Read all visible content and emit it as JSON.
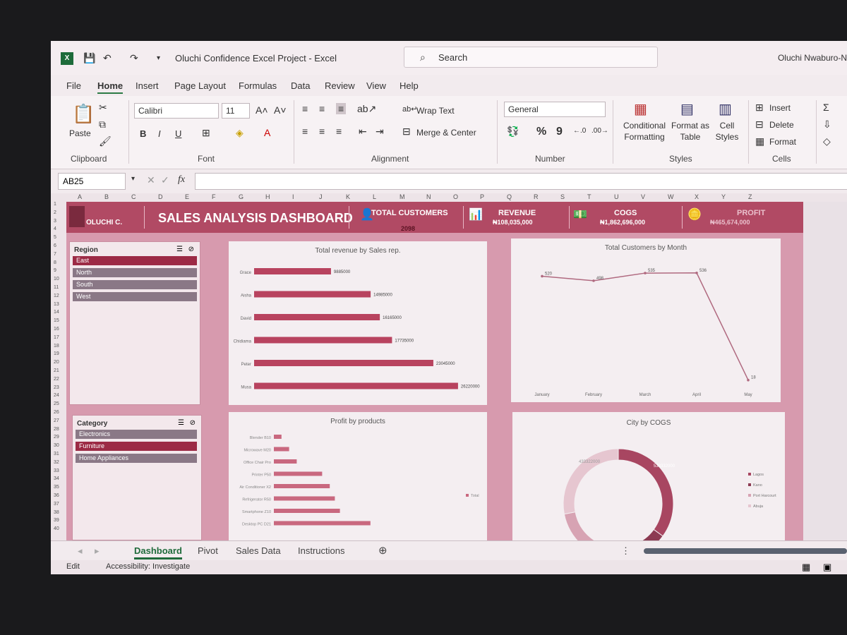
{
  "window": {
    "doc_title": "Oluchi Confidence Excel Project  -  Excel",
    "search_placeholder": "Search",
    "user": "Oluchi Nwaburo-N"
  },
  "menu": [
    "File",
    "Home",
    "Insert",
    "Page Layout",
    "Formulas",
    "Data",
    "Review",
    "View",
    "Help"
  ],
  "ribbon": {
    "paste": "Paste",
    "clipboard": "Clipboard",
    "font_name": "Calibri",
    "font_size": "11",
    "bold": "B",
    "italic": "I",
    "underline": "U",
    "font": "Font",
    "wrap_text": "Wrap Text",
    "merge_center": "Merge & Center",
    "alignment": "Alignment",
    "number_format": "General",
    "percent": "%",
    "comma": "9",
    "number": "Number",
    "conditional_formatting": "Conditional Formatting",
    "format_as_table": "Format as Table",
    "cell_styles": "Cell Styles",
    "styles": "Styles",
    "insert": "Insert",
    "delete": "Delete",
    "format": "Format",
    "cells": "Cells"
  },
  "formula": {
    "name_box": "AB25",
    "fx": "fx"
  },
  "columns": [
    "A",
    "B",
    "C",
    "D",
    "E",
    "F",
    "G",
    "H",
    "I",
    "J",
    "K",
    "L",
    "M",
    "N",
    "O",
    "P",
    "Q",
    "R",
    "S",
    "T",
    "U",
    "V",
    "W",
    "X",
    "Y",
    "Z"
  ],
  "rows": [
    "1",
    "2",
    "3",
    "4",
    "5",
    "6",
    "7",
    "8",
    "9",
    "10",
    "11",
    "12",
    "13",
    "14",
    "15",
    "16",
    "17",
    "18",
    "19",
    "20",
    "21",
    "22",
    "23",
    "24",
    "25",
    "26",
    "27",
    "28",
    "29",
    "30",
    "31",
    "32",
    "33",
    "34",
    "35",
    "36",
    "37",
    "38",
    "39",
    "40"
  ],
  "dashboard": {
    "title": "SALES ANALYSIS DASHBOARD",
    "brand": "OLUCHI C.",
    "kpis": {
      "customers_label": "TOTAL CUSTOMERS",
      "customers_value": "2098",
      "revenue_label": "REVENUE",
      "revenue_value": "₦108,035,000",
      "cogs_label": "COGS",
      "cogs_value": "₦1,862,696,000",
      "profit_label": "PROFIT",
      "profit_value": "₦465,674,000"
    },
    "region_slicer": {
      "title": "Region",
      "items": [
        "East",
        "North",
        "South",
        "West"
      ],
      "selected": "East"
    },
    "category_slicer": {
      "title": "Category",
      "items": [
        "Electronics",
        "Furniture",
        "Home Appliances"
      ],
      "selected": "Furniture"
    },
    "colors": {
      "band": "#b14a64",
      "bar": "#b8435f",
      "selected": "#9c2a45",
      "unselected": "#8a7886"
    }
  },
  "chart_data": [
    {
      "type": "bar",
      "title": "Total revenue by Sales rep.",
      "categories": [
        "Grace",
        "Aisha",
        "David",
        "Chidiama",
        "Peter",
        "Musa"
      ],
      "values": [
        9885000,
        14985000,
        16165000,
        17735000,
        23045000,
        26220000
      ],
      "labels": [
        "9885000",
        "14985000",
        "16165000",
        "17735000",
        "23045000",
        "26220000"
      ],
      "xlim": [
        0,
        26500000
      ]
    },
    {
      "type": "line",
      "title": "Total Customers by Month",
      "categories": [
        "January",
        "February",
        "March",
        "April",
        "May"
      ],
      "values": [
        520,
        498,
        535,
        536,
        18
      ],
      "labels": [
        "520",
        "498",
        "535",
        "536",
        "18"
      ],
      "ylim": [
        0,
        600
      ]
    },
    {
      "type": "bar",
      "title": "Profit by products",
      "categories": [
        "Blender B10",
        "Microwave M20",
        "Office Chair Pro",
        "Printer P50",
        "Air Conditioner X2",
        "Refrigerator R50",
        "Smartphone Z10",
        "Desktop PC D21"
      ],
      "values": [
        3,
        6,
        9,
        19,
        22,
        24,
        26,
        38
      ],
      "legend": "Total",
      "xlim": [
        0,
        40
      ]
    },
    {
      "type": "pie",
      "title": "City by COGS",
      "categories": [
        "Lagos",
        "Kano",
        "Port Harcourt",
        "Abuja"
      ],
      "values": [
        35,
        15,
        22,
        28
      ],
      "labels": [
        "433322000",
        "538332000"
      ],
      "legend": [
        "Lagos",
        "Kano",
        "Port Harcourt",
        "Abuja"
      ]
    }
  ],
  "sheet_tabs": [
    "Dashboard",
    "Pivot",
    "Sales Data",
    "Instructions"
  ],
  "status": {
    "mode": "Edit",
    "accessibility": "Accessibility: Investigate"
  }
}
